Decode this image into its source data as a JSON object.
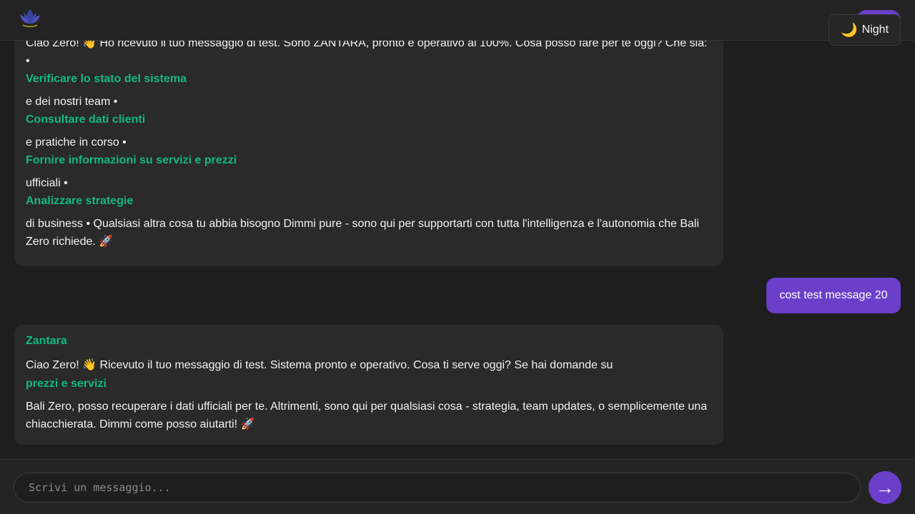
{
  "header": {
    "logo_icon": "lotus-icon",
    "theme_toggle": {
      "icon": "moon-icon",
      "icon_glyph": "🌙",
      "label": "Night"
    }
  },
  "messages": [
    {
      "role": "assistant",
      "segments": [
        {
          "type": "text",
          "value": "Ciao Zero! 👋 Ho ricevuto il tuo messaggio di test. Sono ZANTARA, pronto e operativo al 100%. Cosa posso fare per te oggi? Che sia: •"
        },
        {
          "type": "link",
          "value": "Verificare lo stato del sistema"
        },
        {
          "type": "text",
          "value": "e dei nostri team •"
        },
        {
          "type": "link",
          "value": "Consultare dati clienti"
        },
        {
          "type": "text",
          "value": "e pratiche in corso •"
        },
        {
          "type": "link",
          "value": "Fornire informazioni su servizi e prezzi"
        },
        {
          "type": "text",
          "value": "ufficiali •"
        },
        {
          "type": "link",
          "value": "Analizzare strategie"
        },
        {
          "type": "text",
          "value": "di business • Qualsiasi altra cosa tu abbia bisogno Dimmi pure - sono qui per supportarti con tutta l'intelligenza e l'autonomia che Bali Zero richiede. 🚀"
        }
      ]
    },
    {
      "role": "user",
      "text": "cost test message 20"
    },
    {
      "role": "assistant",
      "sender": "Zantara",
      "segments": [
        {
          "type": "text",
          "value": "Ciao Zero! 👋 Ricevuto il tuo messaggio di test. Sistema pronto e operativo. Cosa ti serve oggi? Se hai domande su"
        },
        {
          "type": "link",
          "value": "prezzi e servizi"
        },
        {
          "type": "text",
          "value": "Bali Zero, posso recuperare i dati ufficiali per te. Altrimenti, sono qui per qualsiasi cosa - strategia, team updates, o semplicemente una chiacchierata. Dimmi come posso aiutarti! 🚀"
        }
      ]
    }
  ],
  "composer": {
    "placeholder": "Scrivi un messaggio...",
    "value": "",
    "send_icon": "arrow-right-icon",
    "send_glyph": "→"
  },
  "colors": {
    "background": "#1e1e1e",
    "bubble": "#2a2a2a",
    "accent_purple": "#6b3fc9",
    "link_green": "#10b981"
  }
}
